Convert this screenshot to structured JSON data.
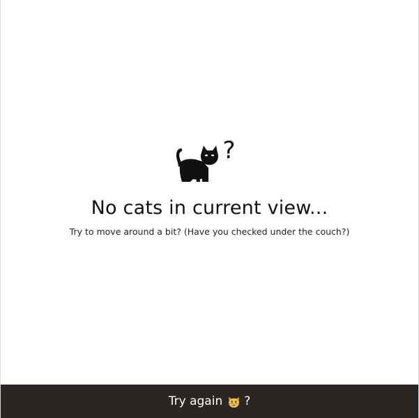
{
  "empty_state": {
    "icon": "cat-icon",
    "badge_icon": "question-mark-icon",
    "badge_text": "?",
    "title": "No cats in current view...",
    "subtitle": "Try to move around a bit? (Have you checked under the couch?)"
  },
  "retry_bar": {
    "label": "Try again",
    "emoji_icon": "grinning-cat-face-icon",
    "suffix": "?",
    "background_color": "#2a2624",
    "text_color": "#ffffff"
  }
}
